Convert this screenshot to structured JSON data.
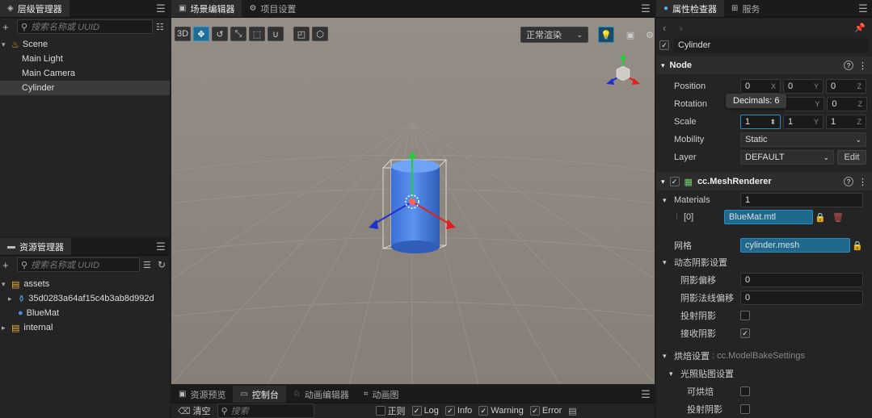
{
  "hierarchy": {
    "tab_label": "层级管理器",
    "search_placeholder": "搜索名称或 UUID",
    "nodes": [
      "Scene",
      "Main Light",
      "Main Camera",
      "Cylinder"
    ]
  },
  "assets": {
    "tab_label": "资源管理器",
    "search_placeholder": "搜索名称或 UUID",
    "items": [
      "assets",
      "35d0283a64af15c4b3ab8d992d",
      "BlueMat",
      "internal"
    ]
  },
  "scene": {
    "tab_scene": "场景编辑器",
    "tab_project": "项目设置",
    "btn_3d": "3D",
    "render_mode": "正常渲染"
  },
  "bottom": {
    "tabs": [
      "资源预览",
      "控制台",
      "动画编辑器",
      "动画图"
    ],
    "clear_label": "清空",
    "search_placeholder": "搜索",
    "regex_label": "正则",
    "filters": [
      "Log",
      "Info",
      "Warning",
      "Error"
    ]
  },
  "inspector": {
    "tab_label": "属性检查器",
    "tab_service": "服务",
    "node_name": "Cylinder",
    "node_section": "Node",
    "position_label": "Position",
    "position": [
      "0",
      "0",
      "0"
    ],
    "rotation_label": "Rotation",
    "rotation_z": "0",
    "scale_label": "Scale",
    "scale": [
      "1",
      "1",
      "1"
    ],
    "tooltip": "Decimals: 6",
    "axes": [
      "X",
      "Y",
      "Z"
    ],
    "mobility_label": "Mobility",
    "mobility_value": "Static",
    "layer_label": "Layer",
    "layer_value": "DEFAULT",
    "edit_label": "Edit",
    "mesh_renderer": "cc.MeshRenderer",
    "materials_label": "Materials",
    "materials_count": "1",
    "material_index": "[0]",
    "material_value": "BlueMat.mtl",
    "mesh_label": "网格",
    "mesh_value": "cylinder.mesh",
    "shadow_section": "动态阴影设置",
    "shadow_bias_label": "阴影偏移",
    "shadow_bias": "0",
    "shadow_normal_bias_label": "阴影法线偏移",
    "shadow_normal_bias": "0",
    "cast_shadow_label": "投射阴影",
    "receive_shadow_label": "接收阴影",
    "bake_section": "烘焙设置",
    "bake_type": ": cc.ModelBakeSettings",
    "lightmap_section": "光照贴图设置",
    "bakeable_label": "可烘焙",
    "cast_shadow2_label": "投射阴影"
  }
}
